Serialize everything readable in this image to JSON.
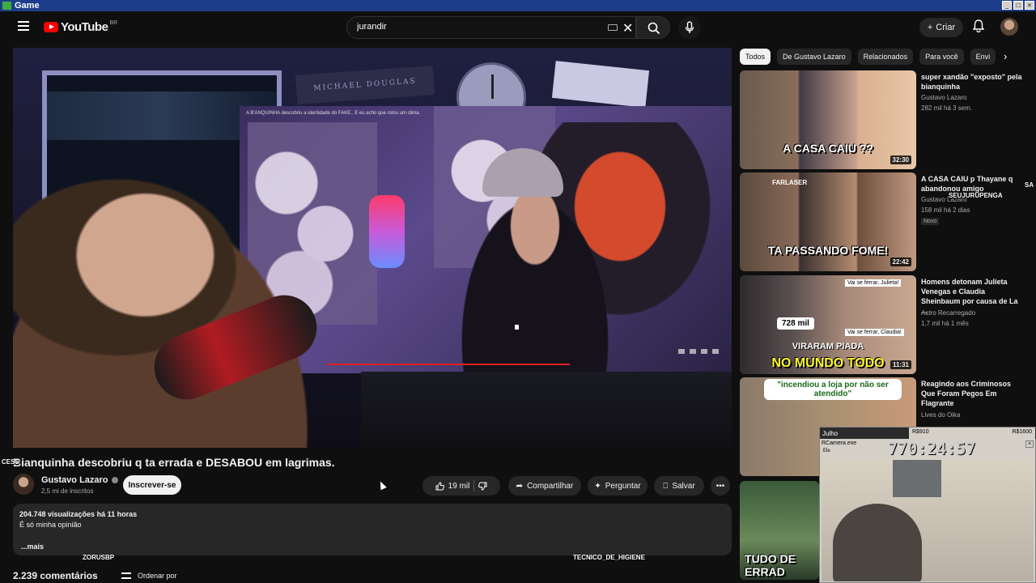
{
  "window": {
    "title": "Game",
    "controls": [
      "_",
      "□",
      "×"
    ]
  },
  "header": {
    "logo_text": "YouTube",
    "logo_region": "BR",
    "search_value": "jurandir",
    "create_label": "Criar"
  },
  "player": {
    "inner_caption": "A B'ANQUINHA descobriu a identidade do FAKE.. E eu acho que rolou um clima.",
    "poster_text": "MICHAEL DOUGLAS"
  },
  "video": {
    "title": "Bianquinha descobriu q ta errada e DESABOU em lagrimas.",
    "channel_name": "Gustavo Lazaro",
    "subscribers": "2,5 mi de inscritos",
    "subscribe_label": "Inscrever-se",
    "likes": "19 mil",
    "share_label": "Compartilhar",
    "ask_label": "Perguntar",
    "save_label": "Salvar",
    "stats": "204.748 visualizações  há 11 horas",
    "description": "É só minha opinião",
    "more_label": "...mais",
    "comments_count": "2.239 comentários",
    "sort_label": "Ordenar por"
  },
  "overlays": {
    "left_name": "CESS",
    "bottom_left": "ZORUSBP",
    "bottom_mid": "TECNICO_DE_HIGIENE",
    "right_tag": "SEUJURUPENGA",
    "far_right": "SA"
  },
  "chips": [
    "Todos",
    "De Gustavo Lazaro",
    "Relacionados",
    "Para você",
    "Envi"
  ],
  "recommendations": [
    {
      "title": "super xandão \"exposto\" pela bianquinha",
      "channel": "Gustavo Lazaro",
      "meta": "282 mil  há 3 sem.",
      "duration": "32:30",
      "thumb_text": "A CASA CAIU ??",
      "badge": ""
    },
    {
      "title": "A CASA CAIU p Thayane q abandonou amigo",
      "channel": "Gustavo Lazaro",
      "meta": "158 mil  há 2 dias",
      "duration": "22:42",
      "thumb_text": "TA PASSANDO FOME!",
      "badge": "Novo"
    },
    {
      "title": "Homens detonam Julieta Venegas e Claudia Sheinbaum por causa de La ...",
      "channel": "Astro Recarregado",
      "meta": "1,7 mil  há 1 mês",
      "duration": "11:31",
      "thumb_text": "NO MUNDO TODO",
      "badge": ""
    },
    {
      "title": "Reagindo aos Criminosos Que Foram Pegos Em Flagrante",
      "channel": "Lives do Oika",
      "meta": "",
      "duration": "",
      "thumb_text": "\"incendiou a loja por não ser atendido\"",
      "badge": ""
    },
    {
      "title": "",
      "channel": "",
      "meta": "",
      "duration": "",
      "thumb_text": "TUDO DE ERRAD",
      "badge": ""
    }
  ],
  "rec3_extra": {
    "likes_badge": "728 mil",
    "speech1": "Vai se ferrar, Julieta!",
    "speech2": "Vai se ferrar, Claudia!",
    "top_text": "VIRARAM PIADA"
  },
  "rec2_extra": {
    "label": "FARLASER"
  },
  "timer": {
    "month": "Julho",
    "money_left": "R$910",
    "money_right": "R$1600",
    "digits": "770:24:57",
    "cam_title": "RCamera.exe",
    "cam_label": "Ele"
  },
  "colors": {
    "accent": "#ff0000",
    "background": "#0f0f0f",
    "chip_active": "#f1f1f1"
  }
}
